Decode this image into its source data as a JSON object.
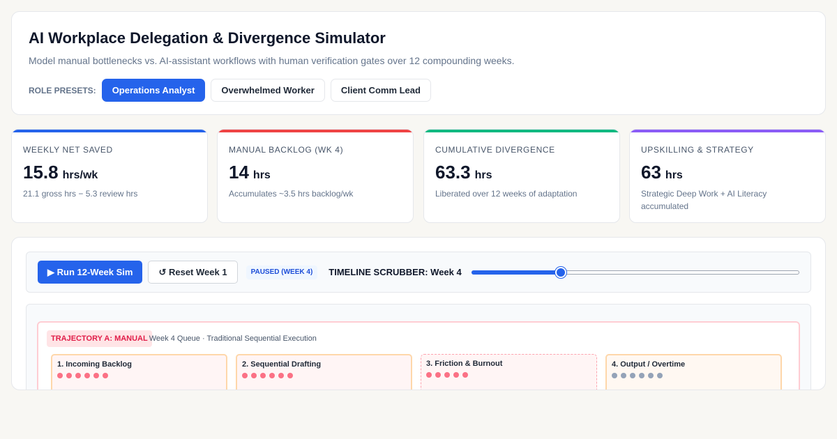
{
  "header": {
    "title": "AI Workplace Delegation & Divergence Simulator",
    "subtitle": "Model manual bottlenecks vs. AI-assistant workflows with human verification gates over 12 compounding weeks.",
    "presets_label": "ROLE PRESETS:",
    "presets": [
      {
        "label": "Operations Analyst",
        "active": true
      },
      {
        "label": "Overwhelmed Worker",
        "active": false
      },
      {
        "label": "Client Comm Lead",
        "active": false
      }
    ]
  },
  "kpis": [
    {
      "label": "WEEKLY NET SAVED",
      "value": "15.8",
      "unit": "hrs/wk",
      "desc": "21.1 gross hrs − 5.3 review hrs",
      "accent": "#2563eb"
    },
    {
      "label": "MANUAL BACKLOG (WK 4)",
      "value": "14",
      "unit": "hrs",
      "desc": "Accumulates ~3.5 hrs backlog/wk",
      "accent": "#ef4444"
    },
    {
      "label": "CUMULATIVE DIVERGENCE",
      "value": "63.3",
      "unit": "hrs",
      "desc": "Liberated over 12 weeks of adaptation",
      "accent": "#10b981"
    },
    {
      "label": "UPSKILLING & STRATEGY",
      "value": "63",
      "unit": "hrs",
      "desc": "Strategic Deep Work + AI Literacy accumulated",
      "accent": "#8b5cf6"
    }
  ],
  "controls": {
    "run_label": "▶ Run 12-Week Sim",
    "reset_label": "↺ Reset Week 1",
    "status": "PAUSED (WEEK 4)",
    "scrubber_label": "TIMELINE SCRUBBER: Week 4",
    "week": 4,
    "week_min": 1,
    "week_max": 12
  },
  "trajectory_a": {
    "tag": "TRAJECTORY A: MANUAL",
    "subtitle": "Week 4 Queue · Traditional Sequential Execution",
    "stages": [
      {
        "title": "1. Incoming Backlog",
        "dots": 6
      },
      {
        "title": "2. Sequential Drafting",
        "dots": 6
      },
      {
        "title": "3. Friction & Burnout",
        "dots": 5
      },
      {
        "title": "4. Output / Overtime",
        "dots": 6
      }
    ]
  },
  "colors": {
    "primary": "#2563eb",
    "manual_accent": "#e11d48"
  }
}
